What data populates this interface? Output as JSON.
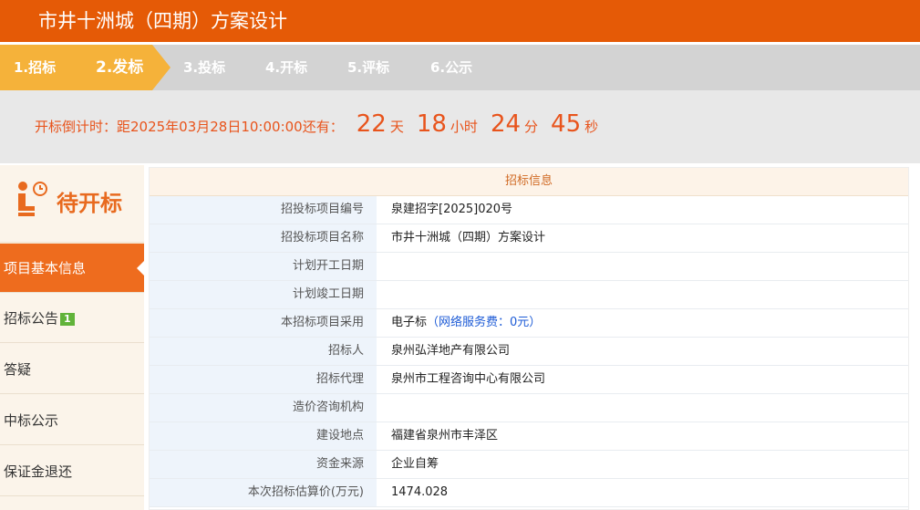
{
  "header": {
    "title": "市井十洲城（四期）方案设计"
  },
  "steps": [
    {
      "label": "1.招标"
    },
    {
      "label": "2.发标"
    },
    {
      "label": "3.投标"
    },
    {
      "label": "4.开标"
    },
    {
      "label": "5.评标"
    },
    {
      "label": "6.公示"
    }
  ],
  "countdown": {
    "label": "开标倒计时：距2025年03月28日10:00:00还有：",
    "days": "22",
    "days_unit": "天",
    "hours": "18",
    "hours_unit": "小时",
    "minutes": "24",
    "minutes_unit": "分",
    "seconds": "45",
    "seconds_unit": "秒"
  },
  "sidebar": {
    "status": "待开标",
    "items": [
      {
        "label": "项目基本信息"
      },
      {
        "label": "招标公告",
        "badge": "1"
      },
      {
        "label": "答疑"
      },
      {
        "label": "中标公示"
      },
      {
        "label": "保证金退还"
      }
    ]
  },
  "panel": {
    "title": "招标信息",
    "rows": [
      {
        "key": "招投标项目编号",
        "value": "泉建招字[2025]020号"
      },
      {
        "key": "招投标项目名称",
        "value": "市井十洲城（四期）方案设计"
      },
      {
        "key": "计划开工日期",
        "value": ""
      },
      {
        "key": "计划竣工日期",
        "value": ""
      },
      {
        "key": "本招标项目采用",
        "value": "电子标",
        "extra": "（网络服务费：0元）"
      },
      {
        "key": "招标人",
        "value": "泉州弘洋地产有限公司"
      },
      {
        "key": "招标代理",
        "value": "泉州市工程咨询中心有限公司"
      },
      {
        "key": "造价咨询机构",
        "value": ""
      },
      {
        "key": "建设地点",
        "value": "福建省泉州市丰泽区"
      },
      {
        "key": "资金来源",
        "value": "企业自筹"
      },
      {
        "key": "本次招标估算价(万元)",
        "value": "1474.028"
      }
    ]
  },
  "colors": {
    "brand": "#e55a06",
    "accent": "#f5b23a",
    "countdown": "#e8541c",
    "link": "#1d5bd6"
  }
}
